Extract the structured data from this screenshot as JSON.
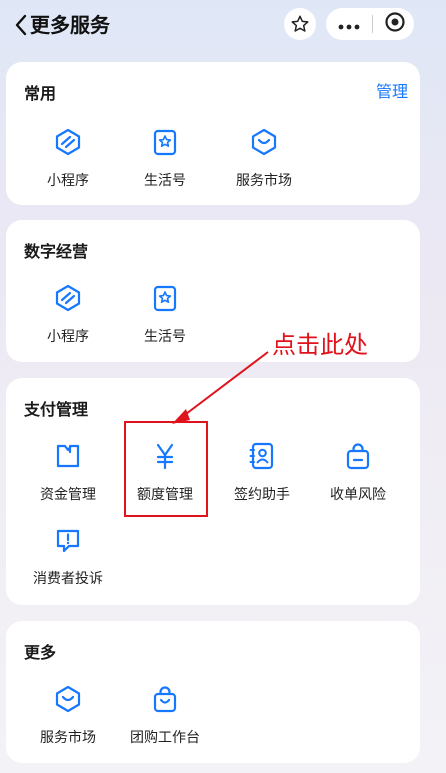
{
  "nav": {
    "title": "更多服务"
  },
  "sections": {
    "common": {
      "title": "常用",
      "action": "管理",
      "items": [
        {
          "label": "小程序",
          "icon": "mini-program-icon"
        },
        {
          "label": "生活号",
          "icon": "life-account-icon"
        },
        {
          "label": "服务市场",
          "icon": "service-market-icon"
        }
      ]
    },
    "digital": {
      "title": "数字经营",
      "items": [
        {
          "label": "小程序",
          "icon": "mini-program-icon"
        },
        {
          "label": "生活号",
          "icon": "life-account-icon"
        }
      ]
    },
    "payment": {
      "title": "支付管理",
      "items": [
        {
          "label": "资金管理",
          "icon": "fund-management-icon"
        },
        {
          "label": "额度管理",
          "icon": "yuan-icon"
        },
        {
          "label": "签约助手",
          "icon": "contract-assistant-icon"
        },
        {
          "label": "收单风险",
          "icon": "acquiring-risk-icon"
        },
        {
          "label": "消费者投诉",
          "icon": "complaint-icon"
        }
      ]
    },
    "more": {
      "title": "更多",
      "items": [
        {
          "label": "服务市场",
          "icon": "service-market-icon"
        },
        {
          "label": "团购工作台",
          "icon": "group-buy-icon"
        }
      ]
    }
  },
  "annotation": {
    "text": "点击此处",
    "color": "#e0121b"
  },
  "colors": {
    "accent": "#1677ff",
    "annotation": "#e0121b"
  }
}
